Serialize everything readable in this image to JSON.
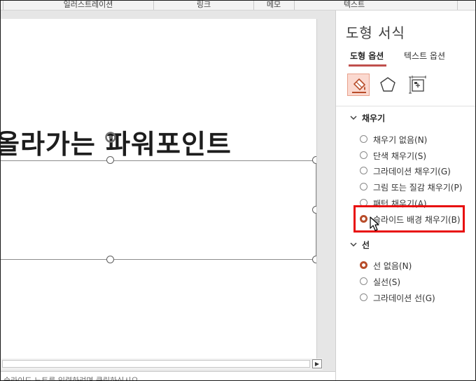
{
  "ribbon": {
    "groups": [
      {
        "label": "일러스트레이션"
      },
      {
        "label": "링크"
      },
      {
        "label": "메모"
      },
      {
        "label": "텍스트"
      }
    ]
  },
  "slide": {
    "title_text": "올라가는 파워포인트",
    "notes_text": "슬라이드 노트를 입력하려면 클릭하십시오"
  },
  "pane": {
    "title": "도형 서식",
    "tabs": [
      {
        "label": "도형 옵션",
        "active": true
      },
      {
        "label": "텍스트 옵션",
        "active": false
      }
    ],
    "icons": [
      "fill-line-icon",
      "effects-pentagon-icon",
      "size-properties-icon"
    ],
    "fill_section": {
      "label": "채우기",
      "options": [
        {
          "label": "채우기 없음(N)",
          "checked": false
        },
        {
          "label": "단색 채우기(S)",
          "checked": false
        },
        {
          "label": "그라데이션 채우기(G)",
          "checked": false
        },
        {
          "label": "그림 또는 질감 채우기(P)",
          "checked": false
        },
        {
          "label": "패턴 채우기(A)",
          "checked": false
        },
        {
          "label": "슬라이드 배경 채우기(B)",
          "checked": true
        }
      ]
    },
    "line_section": {
      "label": "선",
      "options": [
        {
          "label": "선 없음(N)",
          "checked": true
        },
        {
          "label": "실선(S)",
          "checked": false
        },
        {
          "label": "그라데이션 선(G)",
          "checked": false
        }
      ]
    }
  },
  "colors": {
    "accent": "#c0504d",
    "radio_checked": "#b84d2a",
    "highlight": "#e81010",
    "active_icon_bg": "#fbd9d0"
  }
}
